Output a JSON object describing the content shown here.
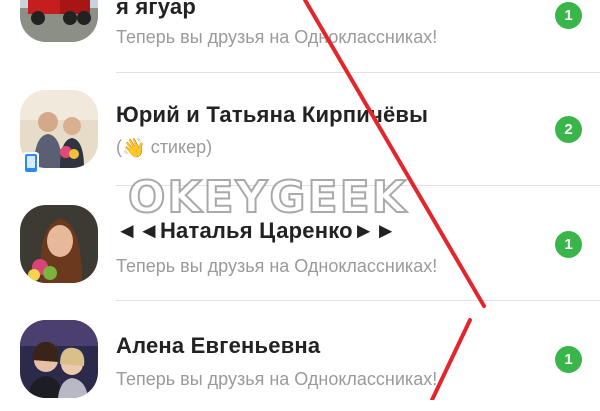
{
  "chats": [
    {
      "name": "я ягуар",
      "preview": "Теперь вы друзья на Одноклассниках!",
      "unread": "1",
      "avatar_icon": "red-truck-avatar"
    },
    {
      "name": "Юрий и Татьяна Кирпичёвы",
      "preview_emoji": "👋",
      "preview_text": "стикер",
      "preview_open": "(",
      "preview_close": ")",
      "unread": "2",
      "avatar_icon": "couple-photo-avatar",
      "device_icon": "mobile-phone-icon"
    },
    {
      "name": "◄◄Наталья Царенко►►",
      "preview": "Теперь вы друзья на Одноклассниках!",
      "unread": "1",
      "avatar_icon": "woman-flowers-avatar"
    },
    {
      "name": "Алена Евгеньевна",
      "preview": "Теперь вы друзья на Одноклассниках!",
      "unread": "1",
      "avatar_icon": "two-women-avatar"
    }
  ],
  "watermark": "OKEYGEEK",
  "colors": {
    "unread_badge": "#39b54a",
    "annotation_line": "#e3262c",
    "device_badge": "#2a8cf0"
  }
}
